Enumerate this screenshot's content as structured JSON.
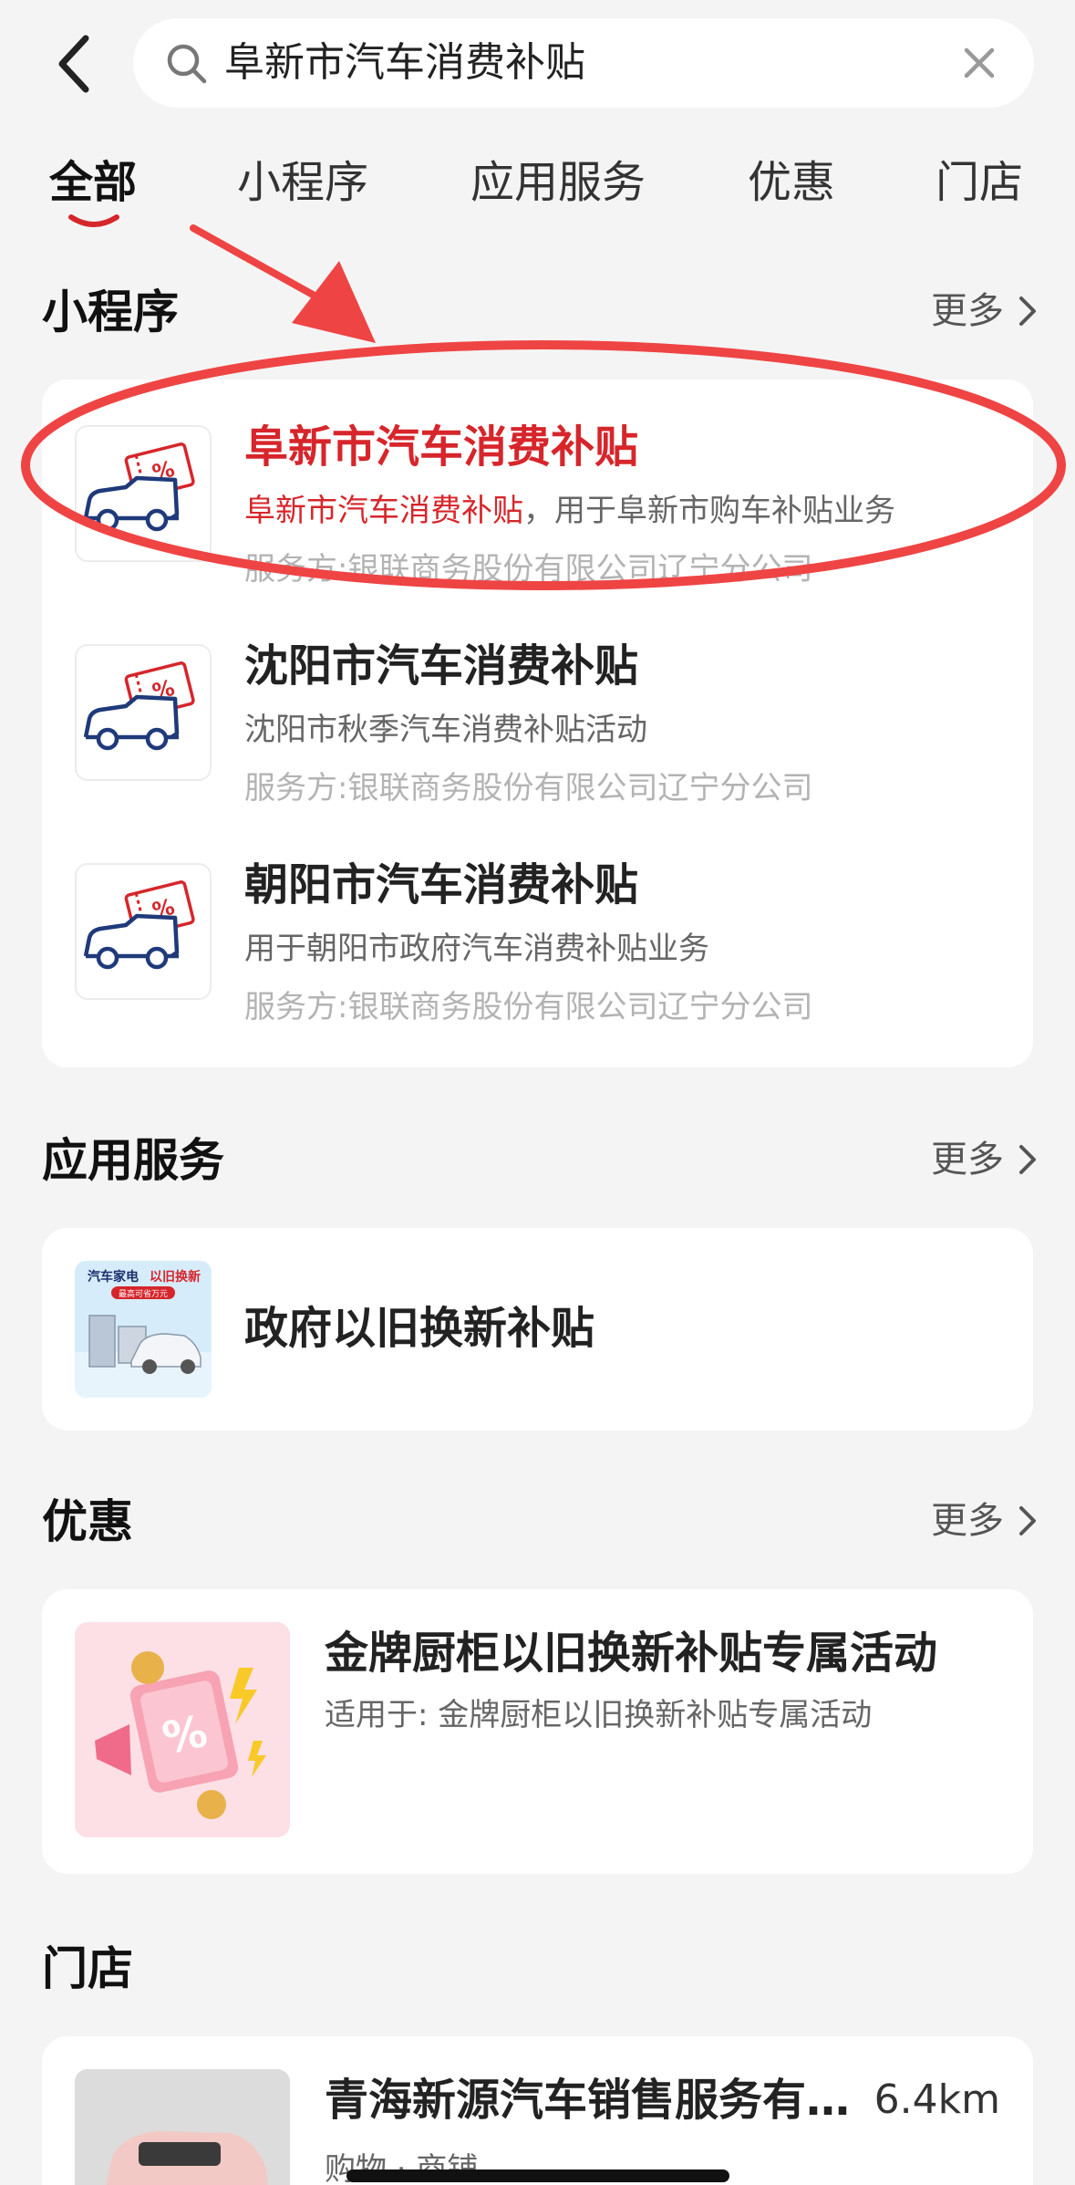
{
  "search": {
    "query": "阜新市汽车消费补贴"
  },
  "tabs": [
    {
      "label": "全部"
    },
    {
      "label": "小程序"
    },
    {
      "label": "应用服务"
    },
    {
      "label": "优惠"
    },
    {
      "label": "门店"
    }
  ],
  "more_label": "更多",
  "mini_programs": {
    "title": "小程序",
    "items": [
      {
        "name": "阜新市汽车消费补贴",
        "desc_highlight": "阜新市汽车消费补贴",
        "desc_rest": "，用于阜新市购车补贴业务",
        "provider": "服务方:银联商务股份有限公司辽宁分公司"
      },
      {
        "name": "沈阳市汽车消费补贴",
        "desc": "沈阳市秋季汽车消费补贴活动",
        "provider": "服务方:银联商务股份有限公司辽宁分公司"
      },
      {
        "name": "朝阳市汽车消费补贴",
        "desc": "用于朝阳市政府汽车消费补贴业务",
        "provider": "服务方:银联商务股份有限公司辽宁分公司"
      }
    ]
  },
  "app_services": {
    "title": "应用服务",
    "items": [
      {
        "name": "政府以旧换新补贴",
        "thumb_text1": "汽车家电",
        "thumb_text2": "以旧换新",
        "thumb_text3": "最高可省万元"
      }
    ]
  },
  "deals": {
    "title": "优惠",
    "items": [
      {
        "name": "金牌厨柜以旧换新补贴专属活动",
        "desc": "适用于: 金牌厨柜以旧换新补贴专属活动"
      }
    ]
  },
  "stores": {
    "title": "门店",
    "items": [
      {
        "name": "青海新源汽车销售服务有…",
        "distance": "6.4km",
        "tags": "购物 · 商铺"
      }
    ]
  },
  "colors": {
    "accent": "#d6262b",
    "background": "#f4f4f4",
    "annotation": "#ef4444"
  }
}
